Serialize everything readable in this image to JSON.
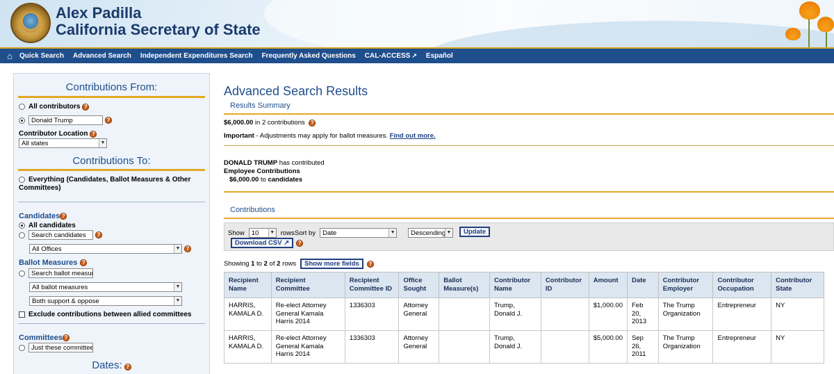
{
  "header": {
    "name": "Alex Padilla",
    "office": "California Secretary of State"
  },
  "nav": {
    "items": [
      "Quick Search",
      "Advanced Search",
      "Independent Expenditures Search",
      "Frequently Asked Questions",
      "CAL-ACCESS",
      "Español"
    ]
  },
  "sidebar": {
    "contributions_from": {
      "heading": "Contributions From:",
      "all_contributors": "All contributors",
      "contributor_name": "Donald Trump",
      "location_label": "Contributor Location",
      "location_value": "All states"
    },
    "contributions_to": {
      "heading": "Contributions To:",
      "everything_line1": "Everything (Candidates, Ballot Measures & Other",
      "everything_line2": "Committees)"
    },
    "candidates": {
      "heading": "Candidates",
      "all": "All candidates",
      "search_placeholder": "Search candidates",
      "offices": "All Offices"
    },
    "ballot_measures": {
      "heading": "Ballot Measures",
      "search_placeholder": "Search ballot measure",
      "all": "All ballot measures",
      "support": "Both support & oppose",
      "exclude": "Exclude contributions between allied committees"
    },
    "committees": {
      "heading": "Committees",
      "just_these": "Just these committees"
    },
    "dates_heading": "Dates:"
  },
  "main": {
    "title": "Advanced Search Results",
    "summary_heading": "Results Summary",
    "summary_amount": "$6,000.00",
    "summary_suffix": "in 2 contributions",
    "important_label": "Important",
    "important_text": "- Adjustments may apply for ballot measures.",
    "find_out_more": "Find out more.",
    "contributor_name": "DONALD TRUMP",
    "has_contributed": "has contributed",
    "employee_contrib": "Employee Contributions",
    "amount_to": "$6,000.00",
    "to_word": "to",
    "candidates_word": "candidates",
    "contributions_heading": "Contributions",
    "toolbar": {
      "show_label": "Show",
      "rows_value": "10",
      "rows_label": "rows",
      "sort_label": "Sort by",
      "sort_value": "Date",
      "order_value": "Descending",
      "update": "Update",
      "download": "Download CSV"
    },
    "showing_prefix": "Showing",
    "showing_from": "1",
    "showing_to_word": "to",
    "showing_to": "2",
    "showing_of_word": "of",
    "showing_total": "2",
    "showing_rows": "rows",
    "show_more_fields": "Show more fields",
    "table": {
      "headers": [
        "Recipient Name",
        "Recipient Committee",
        "Recipient Committee ID",
        "Office Sought",
        "Ballot Measure(s)",
        "Contributor Name",
        "Contributor ID",
        "Amount",
        "Date",
        "Contributor Employer",
        "Contributor Occupation",
        "Contributor State"
      ],
      "rows": [
        [
          "HARRIS, KAMALA D.",
          "Re-elect Attorney General Kamala Harris 2014",
          "1336303",
          "Attorney General",
          "",
          "Trump, Donald J.",
          "",
          "$1,000.00",
          "Feb 20, 2013",
          "The Trump Organization",
          "Entrepreneur",
          "NY"
        ],
        [
          "HARRIS, KAMALA D.",
          "Re-elect Attorney General Kamala Harris 2014",
          "1336303",
          "Attorney General",
          "",
          "Trump, Donald J.",
          "",
          "$5,000.00",
          "Sep 26, 2011",
          "The Trump Organization",
          "Entrepreneur",
          "NY"
        ]
      ]
    }
  }
}
